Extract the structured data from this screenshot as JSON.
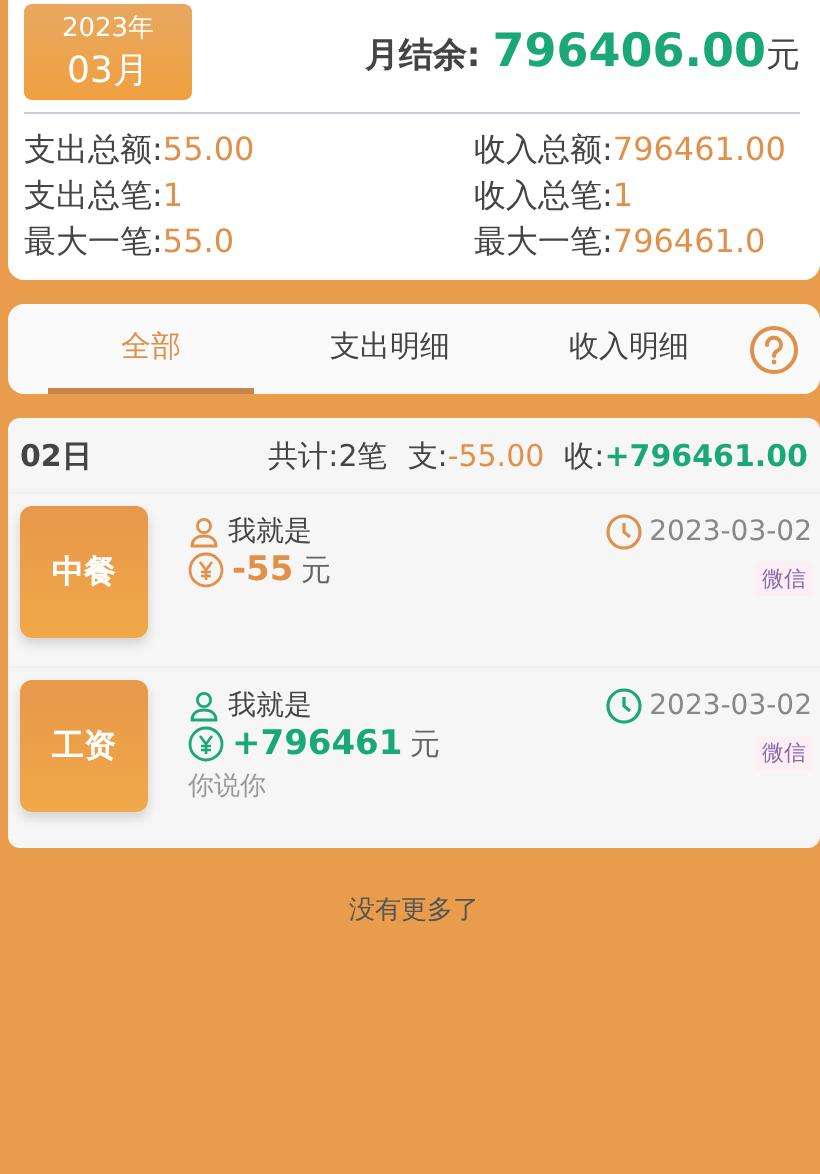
{
  "summary": {
    "year": "2023年",
    "month": "03月",
    "balance_label": "月结余:",
    "balance": "796406.00",
    "balance_unit": "元",
    "stats": [
      {
        "label": "支出总额:",
        "value": "55.00"
      },
      {
        "label": "收入总额:",
        "value": "796461.00"
      },
      {
        "label": "支出总笔:",
        "value": "1"
      },
      {
        "label": "收入总笔:",
        "value": "1"
      },
      {
        "label": "最大一笔:",
        "value": "55.0"
      },
      {
        "label": "最大一笔:",
        "value": "796461.0"
      }
    ]
  },
  "tabs": [
    {
      "label": "全部",
      "selected": true
    },
    {
      "label": "支出明细",
      "selected": false
    },
    {
      "label": "收入明细",
      "selected": false
    }
  ],
  "day": {
    "date": "02日",
    "count": "共计:2笔",
    "expense_label": "支:",
    "expense": "-55.00",
    "income_label": "收:",
    "income": "+796461.00",
    "records": [
      {
        "kind": "expense",
        "category": "中餐",
        "person": "我就是",
        "amount": "-55",
        "unit": "元",
        "date": "2023-03-02",
        "payment": "微信"
      },
      {
        "kind": "income",
        "category": "工资",
        "person": "我就是",
        "amount": "+796461",
        "unit": "元",
        "date": "2023-03-02",
        "payment": "微信",
        "note": "你说你"
      }
    ]
  },
  "footer": "没有更多了"
}
